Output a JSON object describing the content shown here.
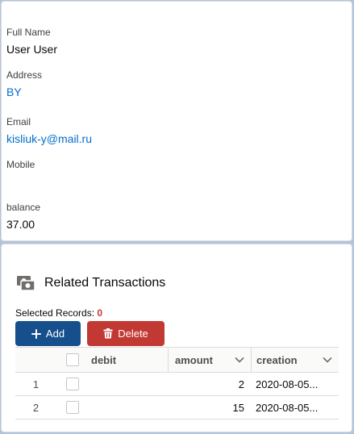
{
  "details": {
    "full_name_label": "Full Name",
    "full_name_value": "User User",
    "address_label": "Address",
    "address_value": "BY",
    "email_label": "Email",
    "email_value": "kisliuk-y@mail.ru",
    "mobile_label": "Mobile",
    "mobile_value": "",
    "balance_label": "balance",
    "balance_value": "37.00"
  },
  "related": {
    "title": "Related Transactions",
    "selected_label": "Selected Records:",
    "selected_count": "0",
    "add_label": "Add",
    "delete_label": "Delete",
    "columns": [
      "debit",
      "amount",
      "creation"
    ],
    "rows": [
      {
        "num": "1",
        "debit": "",
        "amount": "2",
        "creation": "2020-08-05..."
      },
      {
        "num": "2",
        "debit": "",
        "amount": "15",
        "creation": "2020-08-05..."
      }
    ]
  },
  "colors": {
    "link": "#006dcc",
    "brand_button": "#16508c",
    "destructive_button": "#c23934",
    "background": "#b0c4df"
  },
  "icons": [
    "transactions-icon",
    "plus-icon",
    "trash-icon",
    "chevron-down-icon"
  ]
}
